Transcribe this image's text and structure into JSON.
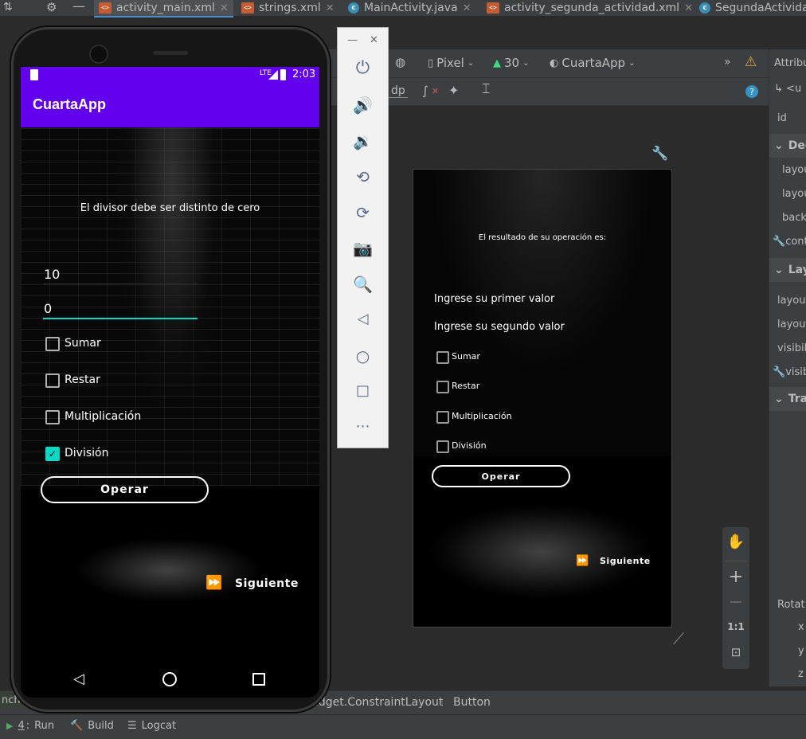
{
  "tabs": [
    {
      "label": "activity_main.xml",
      "type": "xml",
      "active": true
    },
    {
      "label": "strings.xml",
      "type": "xml",
      "active": false
    },
    {
      "label": "MainActivity.java",
      "type": "class",
      "active": false
    },
    {
      "label": "activity_segunda_actividad.xml",
      "type": "xml",
      "active": false
    },
    {
      "label": "SegundaActivida",
      "type": "class",
      "active": false
    }
  ],
  "designer": {
    "device": "Pixel",
    "api": "30",
    "theme": "CuartaApp",
    "dp_label": "dp"
  },
  "attributes_panel": {
    "header": "Attribut",
    "row_u": "<u",
    "id_label": "id",
    "sections": [
      "Dec",
      "Lay",
      "Tra"
    ],
    "declared_rows": [
      "layou",
      "layou",
      "backg",
      "conte"
    ],
    "layout_rows": [
      "layout_",
      "layout_",
      "visibilit",
      "visib"
    ],
    "rotation_label": "Rotat",
    "rotation_axes": [
      "x",
      "y",
      "z"
    ]
  },
  "preview": {
    "result_text": "El resultado de su operación es:",
    "hint_first": "Ingrese su primer valor",
    "hint_second": "Ingrese su segundo valor",
    "checkboxes": [
      "Sumar",
      "Restar",
      "Multiplicación",
      "División"
    ],
    "operar": "Operar",
    "siguiente": "Siguiente"
  },
  "zoom_controls": {
    "one_to_one": "1:1"
  },
  "phone": {
    "status_time": "2:03",
    "status_net": "LTE",
    "app_title": "CuartaApp",
    "message": "El divisor debe ser distinto de cero",
    "input_first": "10",
    "input_second": "0",
    "checkboxes": [
      {
        "label": "Sumar",
        "checked": false
      },
      {
        "label": "Restar",
        "checked": false
      },
      {
        "label": "Multiplicación",
        "checked": false
      },
      {
        "label": "División",
        "checked": true
      }
    ],
    "operar": "Operar",
    "siguiente": "Siguiente",
    "accent": "#6200ee",
    "check_color": "#03dac5"
  },
  "breadcrumb": {
    "left": "nch",
    "path": "idget.ConstraintLayout",
    "leaf": "Button"
  },
  "bottom_tools": {
    "run_num": "4",
    "run": "Run",
    "build": "Build",
    "logcat": "Logcat"
  }
}
